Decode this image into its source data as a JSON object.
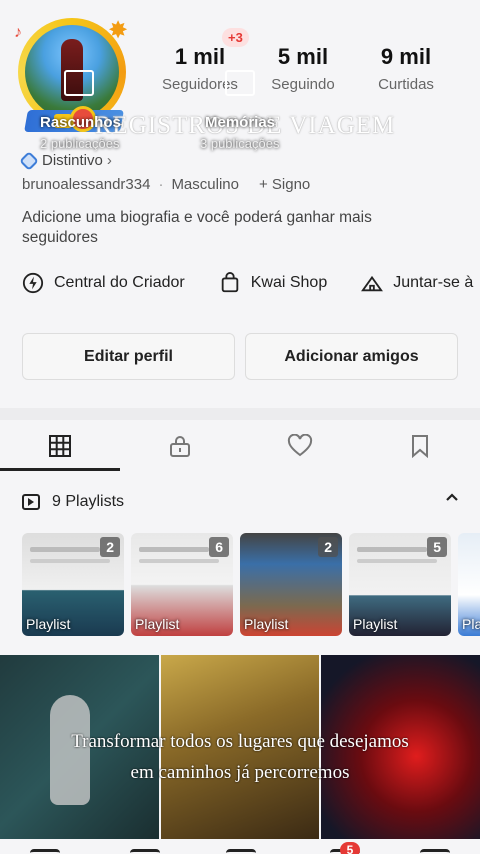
{
  "profile": {
    "stats": [
      {
        "value": "1 mil",
        "label": "Seguidores"
      },
      {
        "value": "5 mil",
        "label": "Seguindo"
      },
      {
        "value": "9 mil",
        "label": "Curtidas"
      }
    ],
    "new_followers_badge": "+3",
    "overlay_title": "REGISTROS DE VIAGEM",
    "badge_label": "Distintivo",
    "badge_chevron": "›",
    "username": "brunoalessandr334",
    "separator": "·",
    "gender": "Masculino",
    "sign": "+ Signo",
    "bio": "Adicione uma biografia e você poderá ganhar mais seguidores"
  },
  "shortcuts": [
    {
      "label": "Central do Criador",
      "icon": "lightning-icon"
    },
    {
      "label": "Kwai Shop",
      "icon": "shopping-bag-icon"
    },
    {
      "label": "Juntar-se à",
      "icon": "tent-icon"
    }
  ],
  "buttons": {
    "edit": "Editar perfil",
    "add_friends": "Adicionar amigos"
  },
  "tabs": [
    {
      "name": "grid-icon",
      "active": true
    },
    {
      "name": "lock-icon",
      "active": false
    },
    {
      "name": "heart-icon",
      "active": false
    },
    {
      "name": "bookmark-icon",
      "active": false
    }
  ],
  "playlists": {
    "header": "9 Playlists",
    "collapse_icon": "chevron-up-icon",
    "items": [
      {
        "count": "2",
        "label": "Playlist"
      },
      {
        "count": "6",
        "label": "Playlist"
      },
      {
        "count": "2",
        "label": "Playlist"
      },
      {
        "count": "5",
        "label": "Playlist"
      },
      {
        "count": "",
        "label": "Pla"
      }
    ]
  },
  "grid": {
    "drafts": {
      "title": "Rascunhos",
      "sub": "2 publicações"
    },
    "memories": {
      "title": "Memórias",
      "sub": "3 publicações"
    }
  },
  "caption": {
    "line1": "Transformar todos os lugares que desejamos",
    "line2": "em caminhos já percorremos"
  },
  "bottom_nav": {
    "notification_count": "5"
  },
  "colors": {
    "accent_red": "#e53935",
    "badge_blue": "#3d7dd8",
    "text_dark": "#222222",
    "background": "#f5f5f7"
  }
}
